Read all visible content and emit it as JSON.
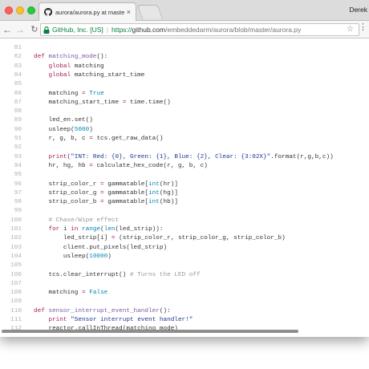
{
  "window": {
    "tab": {
      "title": "aurora/aurora.py at master · em",
      "close": "×",
      "icon": "github-icon"
    },
    "profile": "Derek",
    "colors": {
      "tabstrip": "#dcdcdc",
      "toolbar": "#f6f6f6",
      "secure": "#0b8043"
    }
  },
  "address_bar": {
    "cert_label": "GitHub, Inc. [US]",
    "url_protocol": "https://",
    "url_host": "github.com",
    "url_path": "/embeddedarm/aurora/blob/master/aurora.py"
  },
  "code": {
    "lines": [
      {
        "n": "81",
        "t": []
      },
      {
        "n": "82",
        "t": [
          [
            "kw",
            "def "
          ],
          [
            "fn",
            "matching_mode"
          ],
          [
            "p",
            "():"
          ]
        ]
      },
      {
        "n": "83",
        "t": [
          [
            "p",
            "    "
          ],
          [
            "kw",
            "global"
          ],
          [
            "p",
            " matching"
          ]
        ]
      },
      {
        "n": "84",
        "t": [
          [
            "p",
            "    "
          ],
          [
            "kw",
            "global"
          ],
          [
            "p",
            " matching_start_time"
          ]
        ]
      },
      {
        "n": "85",
        "t": []
      },
      {
        "n": "86",
        "t": [
          [
            "p",
            "    matching "
          ],
          [
            "kw",
            "="
          ],
          [
            "p",
            " "
          ],
          [
            "bi",
            "True"
          ]
        ]
      },
      {
        "n": "87",
        "t": [
          [
            "p",
            "    matching_start_time "
          ],
          [
            "kw",
            "="
          ],
          [
            "p",
            " time.time()"
          ]
        ]
      },
      {
        "n": "88",
        "t": []
      },
      {
        "n": "89",
        "t": [
          [
            "p",
            "    led_en.set()"
          ]
        ]
      },
      {
        "n": "90",
        "t": [
          [
            "p",
            "    usleep("
          ],
          [
            "num",
            "5000"
          ],
          [
            "p",
            ")"
          ]
        ]
      },
      {
        "n": "91",
        "t": [
          [
            "p",
            "    r, g, b, c "
          ],
          [
            "kw",
            "="
          ],
          [
            "p",
            " tcs.get_raw_data()"
          ]
        ]
      },
      {
        "n": "92",
        "t": []
      },
      {
        "n": "93",
        "t": [
          [
            "p",
            "    "
          ],
          [
            "kw",
            "print"
          ],
          [
            "p",
            "("
          ],
          [
            "str",
            "\"INT: Red: {0}, Green: {1}, Blue: {2}, Clear: {3:02X}\""
          ],
          [
            "p",
            ".format(r,g,b,c))"
          ]
        ]
      },
      {
        "n": "94",
        "t": [
          [
            "p",
            "    hr, hg, hb "
          ],
          [
            "kw",
            "="
          ],
          [
            "p",
            " calculate_hex_code(r, g, b, c)"
          ]
        ]
      },
      {
        "n": "95",
        "t": []
      },
      {
        "n": "96",
        "t": [
          [
            "p",
            "    strip_color_r "
          ],
          [
            "kw",
            "="
          ],
          [
            "p",
            " gammatable["
          ],
          [
            "bi",
            "int"
          ],
          [
            "p",
            "(hr)]"
          ]
        ]
      },
      {
        "n": "97",
        "t": [
          [
            "p",
            "    strip_color_g "
          ],
          [
            "kw",
            "="
          ],
          [
            "p",
            " gammatable["
          ],
          [
            "bi",
            "int"
          ],
          [
            "p",
            "(hg)]"
          ]
        ]
      },
      {
        "n": "98",
        "t": [
          [
            "p",
            "    strip_color_b "
          ],
          [
            "kw",
            "="
          ],
          [
            "p",
            " gammatable["
          ],
          [
            "bi",
            "int"
          ],
          [
            "p",
            "(hb)]"
          ]
        ]
      },
      {
        "n": "99",
        "t": []
      },
      {
        "n": "100",
        "t": [
          [
            "cm",
            "    # Chase/Wipe effect"
          ]
        ]
      },
      {
        "n": "101",
        "t": [
          [
            "p",
            "    "
          ],
          [
            "kw",
            "for"
          ],
          [
            "p",
            " i "
          ],
          [
            "kw",
            "in"
          ],
          [
            "p",
            " "
          ],
          [
            "bi",
            "range"
          ],
          [
            "p",
            "("
          ],
          [
            "bi",
            "len"
          ],
          [
            "p",
            "(led_strip)):"
          ]
        ]
      },
      {
        "n": "102",
        "t": [
          [
            "p",
            "        led_strip[i] "
          ],
          [
            "kw",
            "="
          ],
          [
            "p",
            " (strip_color_r, strip_color_g, strip_color_b)"
          ]
        ]
      },
      {
        "n": "103",
        "t": [
          [
            "p",
            "        client.put_pixels(led_strip)"
          ]
        ]
      },
      {
        "n": "104",
        "t": [
          [
            "p",
            "        usleep("
          ],
          [
            "num",
            "10000"
          ],
          [
            "p",
            ")"
          ]
        ]
      },
      {
        "n": "105",
        "t": []
      },
      {
        "n": "106",
        "t": [
          [
            "p",
            "    tcs.clear_interrupt() "
          ],
          [
            "cm",
            "# Turns the LED off"
          ]
        ]
      },
      {
        "n": "107",
        "t": []
      },
      {
        "n": "108",
        "t": [
          [
            "p",
            "    matching "
          ],
          [
            "kw",
            "="
          ],
          [
            "p",
            " "
          ],
          [
            "bi",
            "False"
          ]
        ]
      },
      {
        "n": "109",
        "t": []
      },
      {
        "n": "110",
        "t": [
          [
            "kw",
            "def "
          ],
          [
            "fn",
            "sensor_interrupt_event_handler"
          ],
          [
            "p",
            "():"
          ]
        ]
      },
      {
        "n": "111",
        "t": [
          [
            "p",
            "    "
          ],
          [
            "kw",
            "print"
          ],
          [
            "p",
            " "
          ],
          [
            "str",
            "\"Sensor interrupt event handler!\""
          ]
        ]
      },
      {
        "n": "112",
        "t": [
          [
            "p",
            "    reactor.callInThread(matching_mode)"
          ]
        ]
      }
    ]
  }
}
